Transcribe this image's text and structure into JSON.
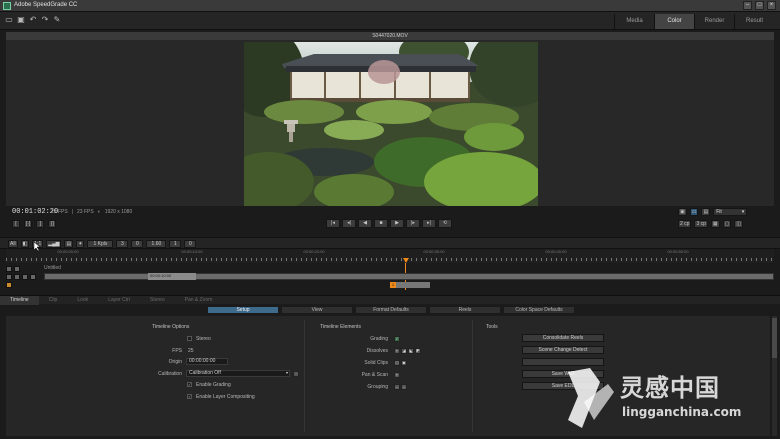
{
  "window": {
    "title": "Adobe SpeedGrade CC"
  },
  "nav": {
    "tabs": [
      "Media",
      "Color",
      "Render",
      "Result"
    ],
    "active": "Color"
  },
  "viewer": {
    "clip_name": "S0447020.MOV"
  },
  "transport": {
    "timecode": "00:01:02:20",
    "fps_a": "25 FPS",
    "fps_b": "23 FPS",
    "resolution": "1920 x 1080",
    "zoom_value": "Fit",
    "zoom_opt1": "2 cp",
    "zoom_opt2": "3 cp"
  },
  "timeline_toolbar": {
    "all_label": "All",
    "one_to_one": "1:1",
    "fields": [
      "1 Kpls",
      "3",
      "0",
      "1.60",
      "1",
      "0"
    ]
  },
  "ruler": {
    "ticks": [
      "00:00:00:00",
      "00:00:10:00",
      "00:00:20:00",
      "00:00:30:00",
      "00:00:40:00",
      "00:00:50:00",
      "00:01:00:00"
    ]
  },
  "track": {
    "label": "Untitled",
    "clip_timecode": "00:00:10:00",
    "marker_num": "1"
  },
  "panel_tabs": {
    "items": [
      "Timeline",
      "Clip",
      "Look",
      "Layer Ctrl",
      "Stereo",
      "Pan & Zoom"
    ],
    "active": "Timeline"
  },
  "settings_tabs": {
    "items": [
      "Setup",
      "View",
      "Format Defaults",
      "Reels",
      "Color Space Defaults"
    ],
    "active": "Setup"
  },
  "timeline_options": {
    "title": "Timeline Options",
    "stereo_label": "Stereo",
    "fps_label": "FPS",
    "fps_value": "25",
    "origin_label": "Origin",
    "origin_value": "00:00:00:00",
    "calibration_label": "Calibration",
    "calibration_value": "Calibration Off",
    "enable_grading": "Enable Grading",
    "enable_layer": "Enable Layer Compositing"
  },
  "timeline_elements": {
    "title": "Timeline Elements",
    "rows": [
      "Grading",
      "Dissolves",
      "Solid Clips",
      "Pan & Scan",
      "Grouping"
    ]
  },
  "tools": {
    "title": "Tools",
    "buttons": [
      "Consolidate Reels",
      "Scene Change Detect",
      "",
      "Save WIO",
      "Save EDL"
    ]
  },
  "watermark": {
    "brand": "灵感中国",
    "url": "lingganchina.com"
  }
}
